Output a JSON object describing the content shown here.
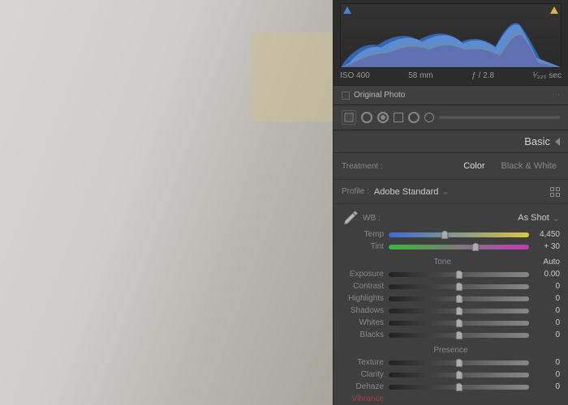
{
  "metadata": {
    "iso": "ISO 400",
    "focal": "58 mm",
    "aperture": "ƒ / 2.8",
    "shutter": "¹⁄₃₂₀ sec"
  },
  "original_photo_label": "Original Photo",
  "section_title": "Basic",
  "treatment": {
    "label": "Treatment :",
    "color": "Color",
    "bw": "Black & White"
  },
  "profile": {
    "label": "Profile :",
    "name": "Adobe Standard"
  },
  "wb": {
    "label": "WB :",
    "value": "As Shot"
  },
  "temp": {
    "label": "Temp",
    "value": "4,450",
    "pos": 40
  },
  "tint": {
    "label": "Tint",
    "value": "+ 30",
    "pos": 62
  },
  "tone": {
    "header": "Tone",
    "auto": "Auto"
  },
  "exposure": {
    "label": "Exposure",
    "value": "0.00",
    "pos": 50
  },
  "contrast": {
    "label": "Contrast",
    "value": "0",
    "pos": 50
  },
  "highlights": {
    "label": "Highlights",
    "value": "0",
    "pos": 50
  },
  "shadows": {
    "label": "Shadows",
    "value": "0",
    "pos": 50
  },
  "whites": {
    "label": "Whites",
    "value": "0",
    "pos": 50
  },
  "blacks": {
    "label": "Blacks",
    "value": "0",
    "pos": 50
  },
  "presence": {
    "header": "Presence"
  },
  "texture": {
    "label": "Texture",
    "value": "0",
    "pos": 50
  },
  "clarity": {
    "label": "Clarity",
    "value": "0",
    "pos": 50
  },
  "dehaze": {
    "label": "Dehaze",
    "value": "0",
    "pos": 50
  },
  "vibrance_label": "Vibrance"
}
